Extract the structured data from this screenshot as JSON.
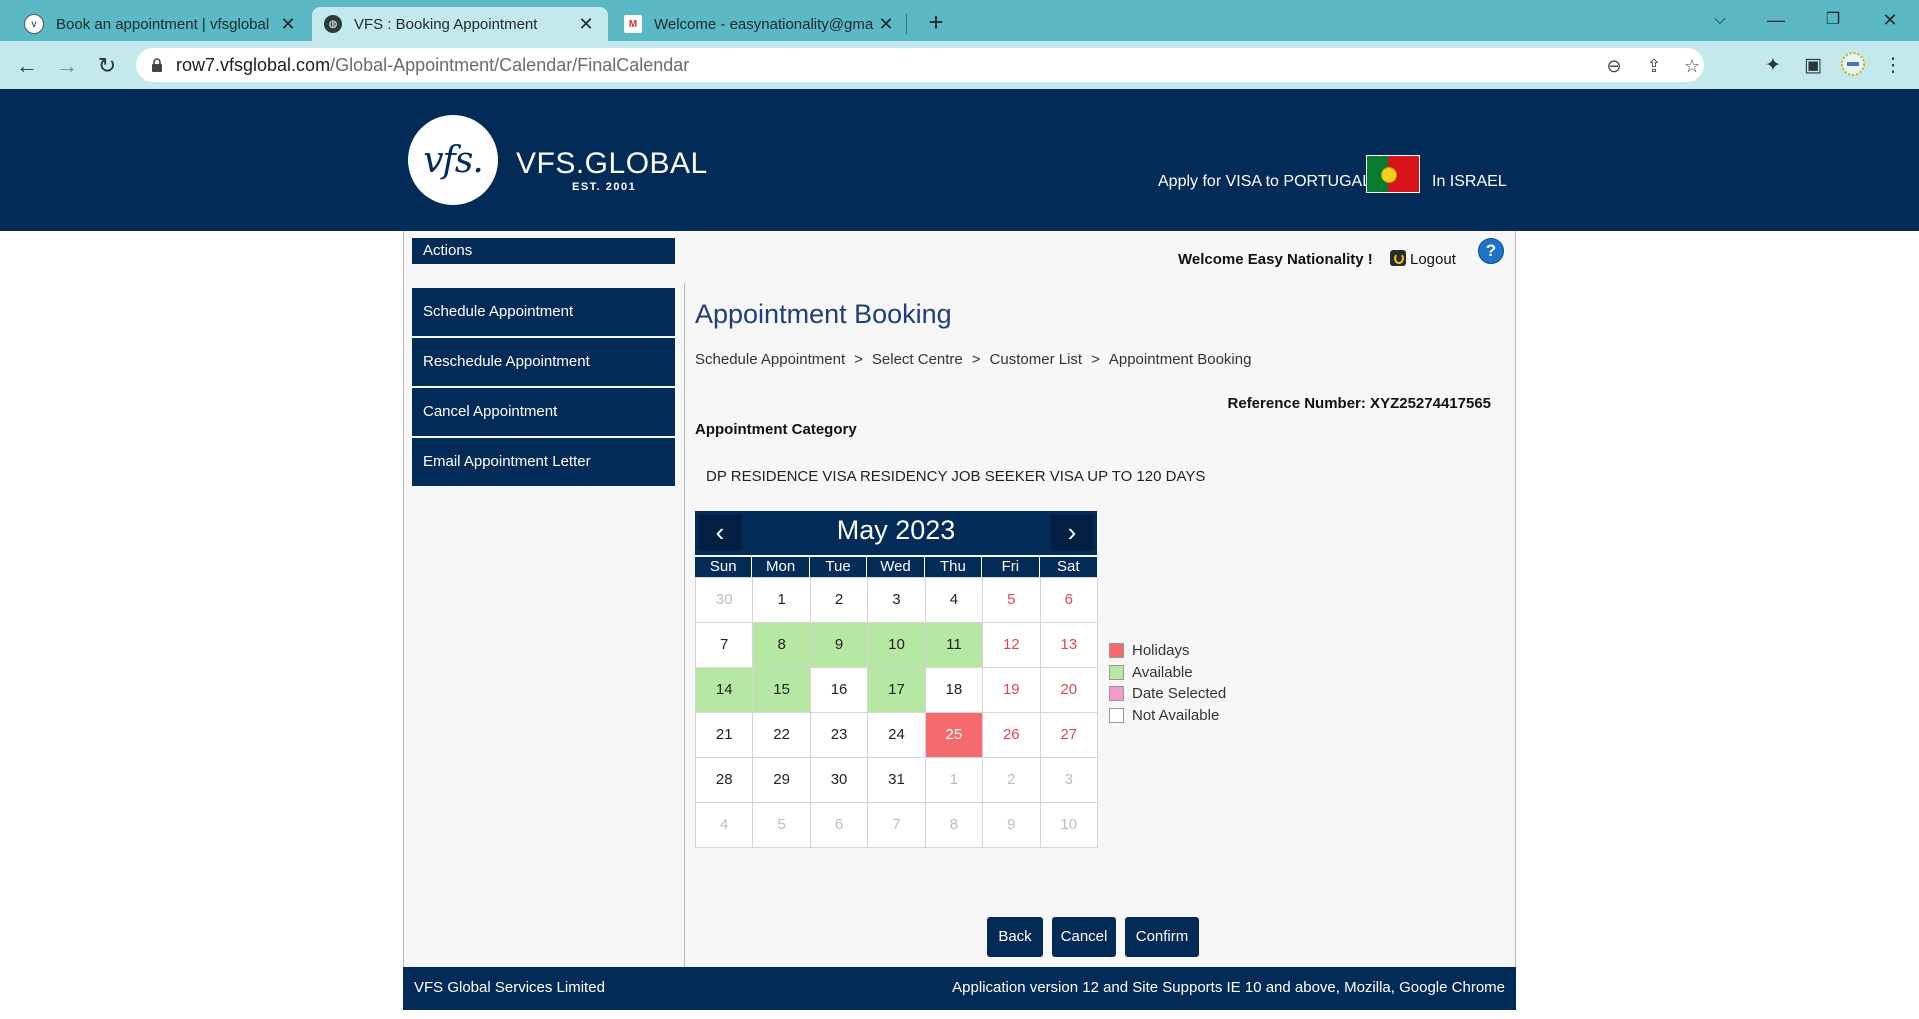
{
  "browser": {
    "tabs": [
      {
        "title": "Book an appointment | vfsglobal",
        "active": false
      },
      {
        "title": "VFS : Booking Appointment",
        "active": true
      },
      {
        "title": "Welcome - easynationality@gma",
        "active": false
      }
    ],
    "url_host": "row7.vfsglobal.com",
    "url_path": "/Global-Appointment/Calendar/FinalCalendar"
  },
  "header": {
    "logo_text": "vfs.",
    "brand": "VFS.GLOBAL",
    "est": "EST. 2001",
    "apply_text": "Apply for VISA to PORTUGAL",
    "location_text": "In ISRAEL"
  },
  "sidebar": {
    "heading": "Actions",
    "items": [
      {
        "label": "Schedule Appointment"
      },
      {
        "label": "Reschedule Appointment"
      },
      {
        "label": "Cancel Appointment"
      },
      {
        "label": "Email Appointment Letter"
      }
    ]
  },
  "user": {
    "welcome": "Welcome Easy Nationality !",
    "logout": "Logout",
    "help": "?"
  },
  "main": {
    "title": "Appointment Booking",
    "breadcrumb": [
      "Schedule Appointment",
      "Select Centre",
      "Customer List",
      "Appointment Booking"
    ],
    "breadcrumb_sep": ">",
    "reference": "Reference Number: XYZ25274417565",
    "category_label": "Appointment Category",
    "category_value": "DP RESIDENCE VISA RESIDENCY JOB SEEKER VISA UP TO 120 DAYS"
  },
  "calendar": {
    "month_label": "May 2023",
    "prev": "‹",
    "next": "›",
    "weekdays": [
      "Sun",
      "Mon",
      "Tue",
      "Wed",
      "Thu",
      "Fri",
      "Sat"
    ],
    "weeks": [
      [
        {
          "d": "30",
          "s": "outside"
        },
        {
          "d": "1",
          "s": "normal"
        },
        {
          "d": "2",
          "s": "normal"
        },
        {
          "d": "3",
          "s": "normal"
        },
        {
          "d": "4",
          "s": "normal"
        },
        {
          "d": "5",
          "s": "weekend"
        },
        {
          "d": "6",
          "s": "weekend"
        }
      ],
      [
        {
          "d": "7",
          "s": "normal"
        },
        {
          "d": "8",
          "s": "avail"
        },
        {
          "d": "9",
          "s": "avail"
        },
        {
          "d": "10",
          "s": "avail"
        },
        {
          "d": "11",
          "s": "avail"
        },
        {
          "d": "12",
          "s": "weekend"
        },
        {
          "d": "13",
          "s": "weekend"
        }
      ],
      [
        {
          "d": "14",
          "s": "avail"
        },
        {
          "d": "15",
          "s": "avail"
        },
        {
          "d": "16",
          "s": "normal"
        },
        {
          "d": "17",
          "s": "avail"
        },
        {
          "d": "18",
          "s": "normal"
        },
        {
          "d": "19",
          "s": "weekend"
        },
        {
          "d": "20",
          "s": "weekend"
        }
      ],
      [
        {
          "d": "21",
          "s": "normal"
        },
        {
          "d": "22",
          "s": "normal"
        },
        {
          "d": "23",
          "s": "normal"
        },
        {
          "d": "24",
          "s": "normal"
        },
        {
          "d": "25",
          "s": "holiday"
        },
        {
          "d": "26",
          "s": "weekend"
        },
        {
          "d": "27",
          "s": "weekend"
        }
      ],
      [
        {
          "d": "28",
          "s": "normal"
        },
        {
          "d": "29",
          "s": "normal"
        },
        {
          "d": "30",
          "s": "normal"
        },
        {
          "d": "31",
          "s": "normal"
        },
        {
          "d": "1",
          "s": "outside"
        },
        {
          "d": "2",
          "s": "outside"
        },
        {
          "d": "3",
          "s": "outside"
        }
      ],
      [
        {
          "d": "4",
          "s": "outside"
        },
        {
          "d": "5",
          "s": "outside"
        },
        {
          "d": "6",
          "s": "outside"
        },
        {
          "d": "7",
          "s": "outside"
        },
        {
          "d": "8",
          "s": "outside"
        },
        {
          "d": "9",
          "s": "outside"
        },
        {
          "d": "10",
          "s": "outside"
        }
      ]
    ],
    "legend": [
      {
        "label": "Holidays",
        "color": "#f56a6c"
      },
      {
        "label": "Available",
        "color": "#b6e8a3"
      },
      {
        "label": "Date Selected",
        "color": "#f59ac8"
      },
      {
        "label": "Not Available",
        "color": "#ffffff"
      }
    ]
  },
  "actions": {
    "back": "Back",
    "cancel": "Cancel",
    "confirm": "Confirm"
  },
  "footer": {
    "left": "VFS Global Services Limited",
    "right": "Application version 12 and Site Supports IE 10 and above, Mozilla, Google Chrome"
  },
  "colors": {
    "brand_navy": "#032b57",
    "browser_teal": "#5ab9c4",
    "available": "#b6e8a3",
    "holiday": "#f56a6c",
    "title_blue": "#1f3e7a"
  }
}
